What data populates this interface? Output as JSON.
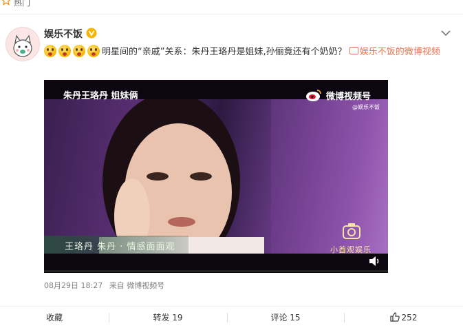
{
  "hot_bar": {
    "label": "热门",
    "star_icon": "star-outline-icon"
  },
  "post": {
    "author": {
      "name": "娱乐不饭",
      "verified_badge": "verified-badge-icon",
      "avatar_icon": "cat-avatar-icon"
    },
    "menu_icon": "chevron-down-icon",
    "emoji_count": 4,
    "text": "明星间的“亲戚”关系：朱丹王珞丹是姐妹,孙俪竟还有个奶奶？",
    "link_icon": "video-link-icon",
    "link_text": "娱乐不饭的微博视频",
    "video": {
      "overlay_title": "朱丹王珞丹 姐妹俩",
      "watermark": "微博视频号",
      "watermark_sub": "@娱乐不饭",
      "subtitle": "王珞丹 朱丹 · 情感面面观",
      "channel_name": "小酋观娱乐",
      "speaker_icon": "speaker-icon",
      "progress": 0
    },
    "meta": {
      "time": "08月29日 18:27",
      "source": "来自 微博视频号"
    },
    "actions": {
      "favorite": "收藏",
      "repost": "转发 19",
      "comment": "评论 15",
      "like_count": "252"
    }
  },
  "colors": {
    "link": "#eb7350",
    "badge": "#f8b400",
    "progress": "#ff8200"
  }
}
